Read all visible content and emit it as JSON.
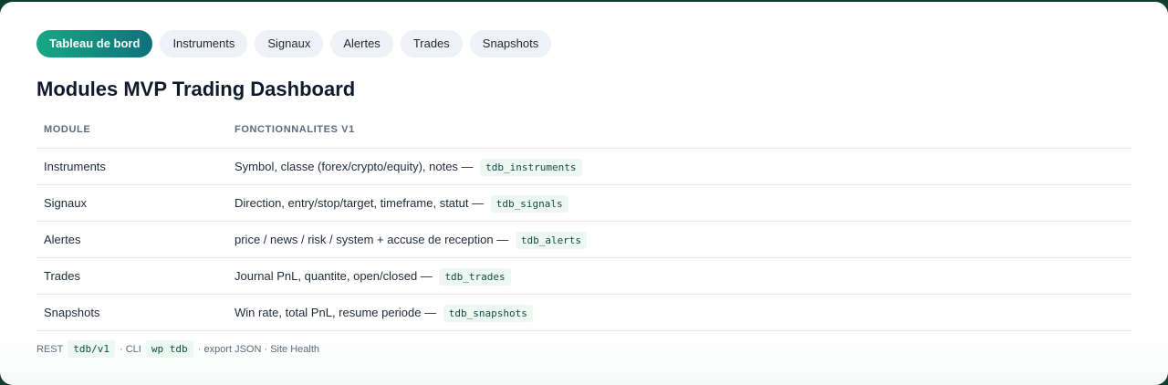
{
  "tabs": [
    {
      "label": "Tableau de bord",
      "active": true
    },
    {
      "label": "Instruments"
    },
    {
      "label": "Signaux"
    },
    {
      "label": "Alertes"
    },
    {
      "label": "Trades"
    },
    {
      "label": "Snapshots"
    }
  ],
  "title": "Modules MVP Trading Dashboard",
  "table": {
    "headers": [
      "MODULE",
      "FONCTIONNALITES V1"
    ],
    "rows": [
      {
        "module": "Instruments",
        "description": "Symbol, classe (forex/crypto/equity), notes —",
        "code": "tdb_instruments"
      },
      {
        "module": "Signaux",
        "description": "Direction, entry/stop/target, timeframe, statut —",
        "code": "tdb_signals"
      },
      {
        "module": "Alertes",
        "description": "price / news / risk / system + accuse de reception —",
        "code": "tdb_alerts"
      },
      {
        "module": "Trades",
        "description": "Journal PnL, quantite, open/closed —",
        "code": "tdb_trades"
      },
      {
        "module": "Snapshots",
        "description": "Win rate, total PnL, resume periode —",
        "code": "tdb_snapshots"
      }
    ]
  },
  "footer": {
    "rest_label": "REST",
    "rest_code": "tdb/v1",
    "cli_label": "· CLI",
    "cli_code": "wp tdb",
    "rest_text": "· export JSON · Site Health"
  },
  "colors": {
    "accent_start": "#17a884",
    "accent_end": "#10707c",
    "background": "#0f3d2e"
  }
}
